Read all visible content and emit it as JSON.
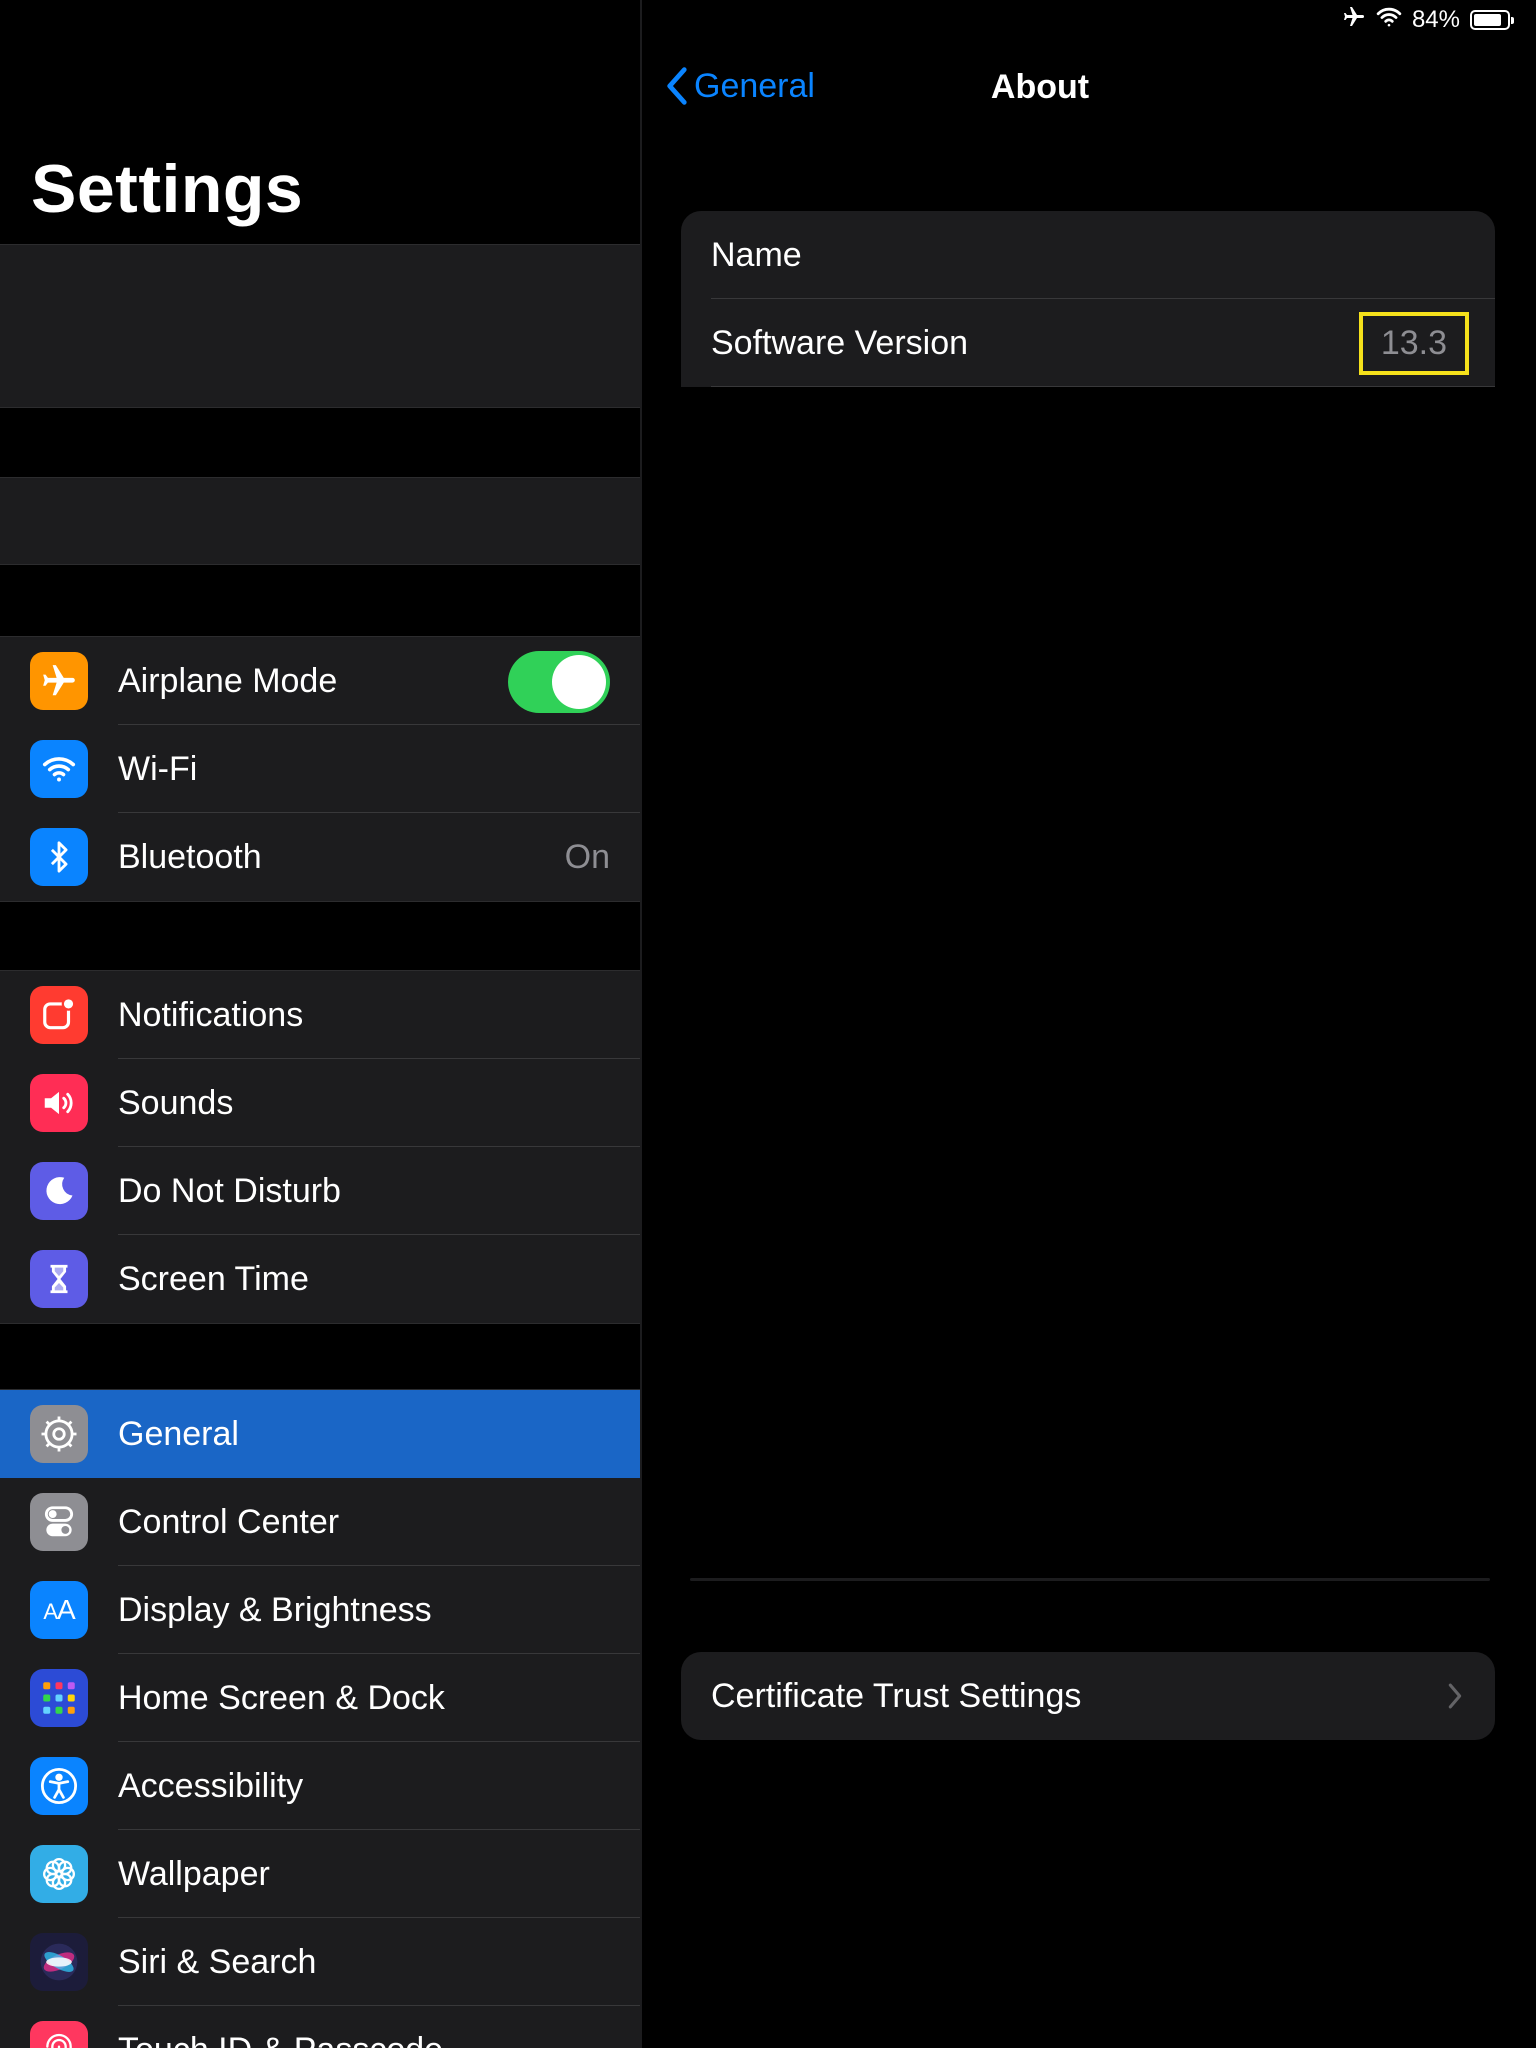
{
  "status_bar": {
    "battery": "84%",
    "battery_level": 0.84
  },
  "sidebar": {
    "title": "Settings",
    "groups": [
      {
        "items": [
          {
            "label": "Airplane Mode",
            "icon": "airplane-icon",
            "color": "#ff9500",
            "toggle_on": true
          },
          {
            "label": "Wi-Fi",
            "icon": "wifi-icon",
            "color": "#0a84ff"
          },
          {
            "label": "Bluetooth",
            "icon": "bluetooth-icon",
            "color": "#0a84ff",
            "value": "On"
          }
        ]
      },
      {
        "items": [
          {
            "label": "Notifications",
            "icon": "notifications-icon",
            "color": "#ff3b30"
          },
          {
            "label": "Sounds",
            "icon": "speaker-icon",
            "color": "#ff2d55"
          },
          {
            "label": "Do Not Disturb",
            "icon": "moon-icon",
            "color": "#5e5ce6"
          },
          {
            "label": "Screen Time",
            "icon": "hourglass-icon",
            "color": "#5e5ce6"
          }
        ]
      },
      {
        "items": [
          {
            "label": "General",
            "icon": "gear-icon",
            "color": "#8e8e93",
            "selected": true
          },
          {
            "label": "Control Center",
            "icon": "switches-icon",
            "color": "#8e8e93"
          },
          {
            "label": "Display & Brightness",
            "icon": "text-size-icon",
            "color": "#0a84ff"
          },
          {
            "label": "Home Screen & Dock",
            "icon": "app-grid-icon",
            "color": "#2c4bd6"
          },
          {
            "label": "Accessibility",
            "icon": "accessibility-icon",
            "color": "#0a84ff"
          },
          {
            "label": "Wallpaper",
            "icon": "flower-icon",
            "color": "#32ade6"
          },
          {
            "label": "Siri & Search",
            "icon": "siri-icon",
            "color": "#1c1c3a"
          },
          {
            "label": "Touch ID & Passcode",
            "icon": "fingerprint-icon",
            "color": "#ff375f"
          }
        ]
      }
    ]
  },
  "detail": {
    "back_label": "General",
    "title": "About",
    "info_rows": [
      {
        "label": "Name",
        "value": ""
      },
      {
        "label": "Software Version",
        "value": "13.3"
      }
    ],
    "certificate_label": "Certificate Trust Settings"
  },
  "colors": {
    "accent": "#0a84ff",
    "selected_row": "#1a66c6",
    "toggle_on": "#30d158",
    "highlight_box": "#f5e11b"
  }
}
